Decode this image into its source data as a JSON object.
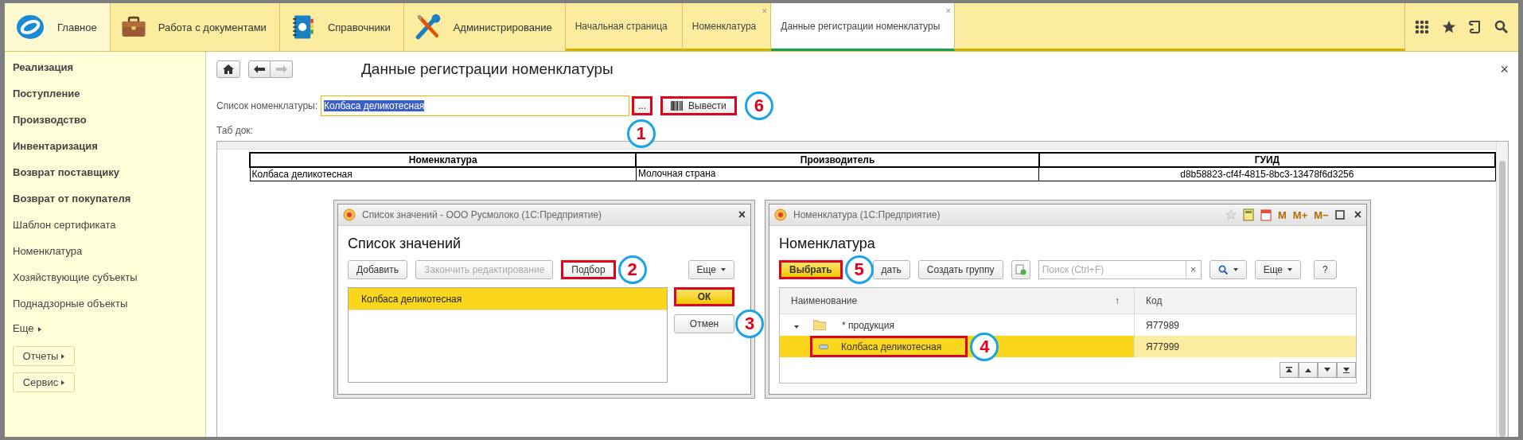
{
  "top_bar": {
    "sections": [
      {
        "label": "Главное",
        "selected": true
      },
      {
        "label": "Работа с документами",
        "selected": false
      },
      {
        "label": "Справочники",
        "selected": false
      },
      {
        "label": "Администрирование",
        "selected": false
      }
    ],
    "tabs": [
      {
        "label": "Начальная страница",
        "selected": false,
        "closable": false
      },
      {
        "label": "Номенклатура",
        "selected": false,
        "closable": true
      },
      {
        "label": "Данные регистрации номенклатуры",
        "selected": true,
        "closable": true
      }
    ],
    "close_mark": "×"
  },
  "sidebar": {
    "items": [
      {
        "label": "Реализация",
        "bold": true
      },
      {
        "label": "Поступление",
        "bold": true
      },
      {
        "label": "Производство",
        "bold": true
      },
      {
        "label": "Инвентаризация",
        "bold": true
      },
      {
        "label": "Возврат поставщику",
        "bold": true
      },
      {
        "label": "Возврат от покупателя",
        "bold": true
      },
      {
        "label": "Шаблон сертификата",
        "bold": false
      },
      {
        "label": "Номенклатура",
        "bold": false
      },
      {
        "label": "Хозяйствующие субъекты",
        "bold": false
      },
      {
        "label": "Поднадзорные объекты",
        "bold": false
      }
    ],
    "more": "Еще",
    "buttons": [
      "Отчеты",
      "Сервис"
    ]
  },
  "page": {
    "title": "Данные регистрации номенклатуры",
    "close": "×",
    "field_label": "Список номенклатуры:",
    "field_value": "Колбаса деликотесная",
    "value_selected": true,
    "choose_button": {
      "label": "...",
      "highlighted": true,
      "marker": "1"
    },
    "output_button": {
      "label": "Вывести",
      "highlighted": true,
      "marker": "6"
    },
    "tab_doc_label": "Таб док:",
    "table": {
      "columns": [
        "Номенклатура",
        "Производитель",
        "ГУИД"
      ],
      "rows": [
        [
          "Колбаса деликотесная",
          "Молочная страна",
          "d8b58823-cf4f-4815-8bc3-13478f6d3256"
        ]
      ]
    }
  },
  "values_dialog": {
    "window_title": "Список значений - ООО Русмолоко  (1С:Предприятие)",
    "close": "×",
    "heading": "Список значений",
    "toolbar": [
      {
        "label": "Добавить",
        "disabled": false,
        "highlighted": false,
        "dropdown": false
      },
      {
        "label": "Закончить редактирование",
        "disabled": true,
        "highlighted": false,
        "dropdown": false
      },
      {
        "label": "Подбор",
        "disabled": false,
        "highlighted": true,
        "dropdown": false,
        "marker": "2"
      },
      {
        "label": "Еще",
        "disabled": false,
        "highlighted": false,
        "dropdown": true
      }
    ],
    "items": [
      {
        "label": "Колбаса деликотесная",
        "selected": true
      }
    ],
    "buttons": [
      {
        "label": "ОК",
        "default": true,
        "highlighted": true
      },
      {
        "label": "Отмен",
        "default": false,
        "highlighted": false,
        "marker": "3"
      }
    ]
  },
  "catalog_dialog": {
    "window_title": "Номенклатура (1С:Предприятие)",
    "title_buttons": [
      "M",
      "M+",
      "M−"
    ],
    "close": "×",
    "heading": "Номенклатура",
    "select_button": {
      "label": "Выбрать",
      "highlighted": true,
      "marker": "5"
    },
    "create_button": "дать",
    "create_group_button": "Создать группу",
    "search": {
      "placeholder": "Поиск (Ctrl+F)",
      "clear": "×"
    },
    "more_button": "Еще",
    "help_button": "?",
    "columns": [
      {
        "label": "Наименование",
        "sort_mark": "↑"
      },
      {
        "label": "Код"
      }
    ],
    "rows": [
      {
        "name": "* продукция",
        "code": "Я77989",
        "kind": "group",
        "expanded": true,
        "selected": false,
        "highlighted": false,
        "children": [
          {
            "name": "Колбаса деликотесная",
            "code": "Я77999",
            "kind": "item",
            "selected": true,
            "highlighted": true,
            "marker": "4"
          }
        ]
      }
    ]
  }
}
